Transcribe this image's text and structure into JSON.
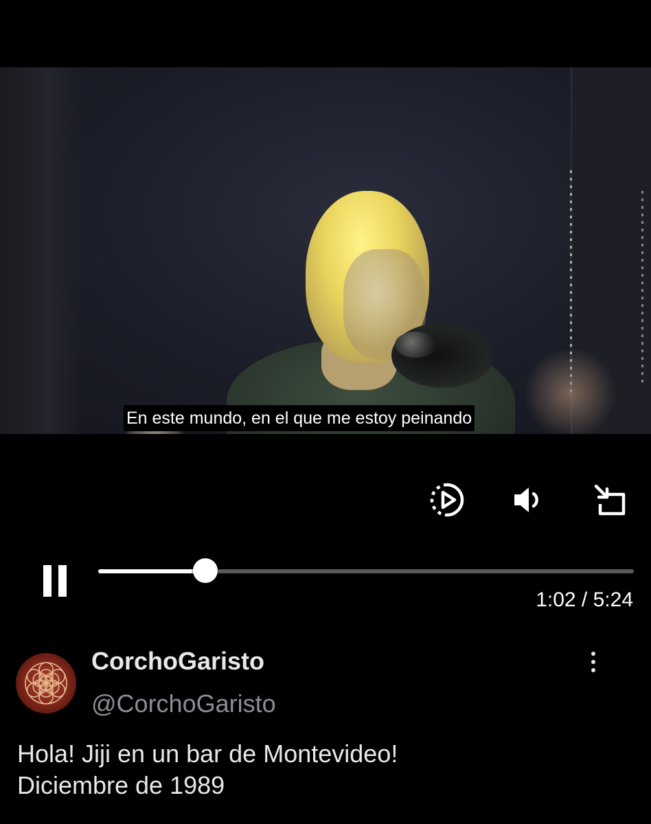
{
  "video": {
    "subtitle": "En este mundo, en el que me estoy peinando",
    "playback_progress_fraction": 0.2,
    "current_time": "1:02",
    "separator": "/",
    "duration": "5:24"
  },
  "controls": {
    "autoplay_icon": "autoplay-icon",
    "volume_icon": "volume-icon",
    "dock_icon": "pip-dock-icon",
    "pause_icon": "pause-icon"
  },
  "post": {
    "display_name": "CorchoGaristo",
    "handle": "@CorchoGaristo",
    "more_icon": "more-vertical-icon",
    "text_lines": [
      "Hola! Jiji en un bar de Montevideo!",
      "Diciembre de 1989"
    ]
  },
  "colors": {
    "background": "#000000",
    "primary_text": "#e7e9ea",
    "secondary_text": "#8b8f94",
    "progress_track": "#5b5b5b",
    "progress_fill": "#ffffff"
  }
}
